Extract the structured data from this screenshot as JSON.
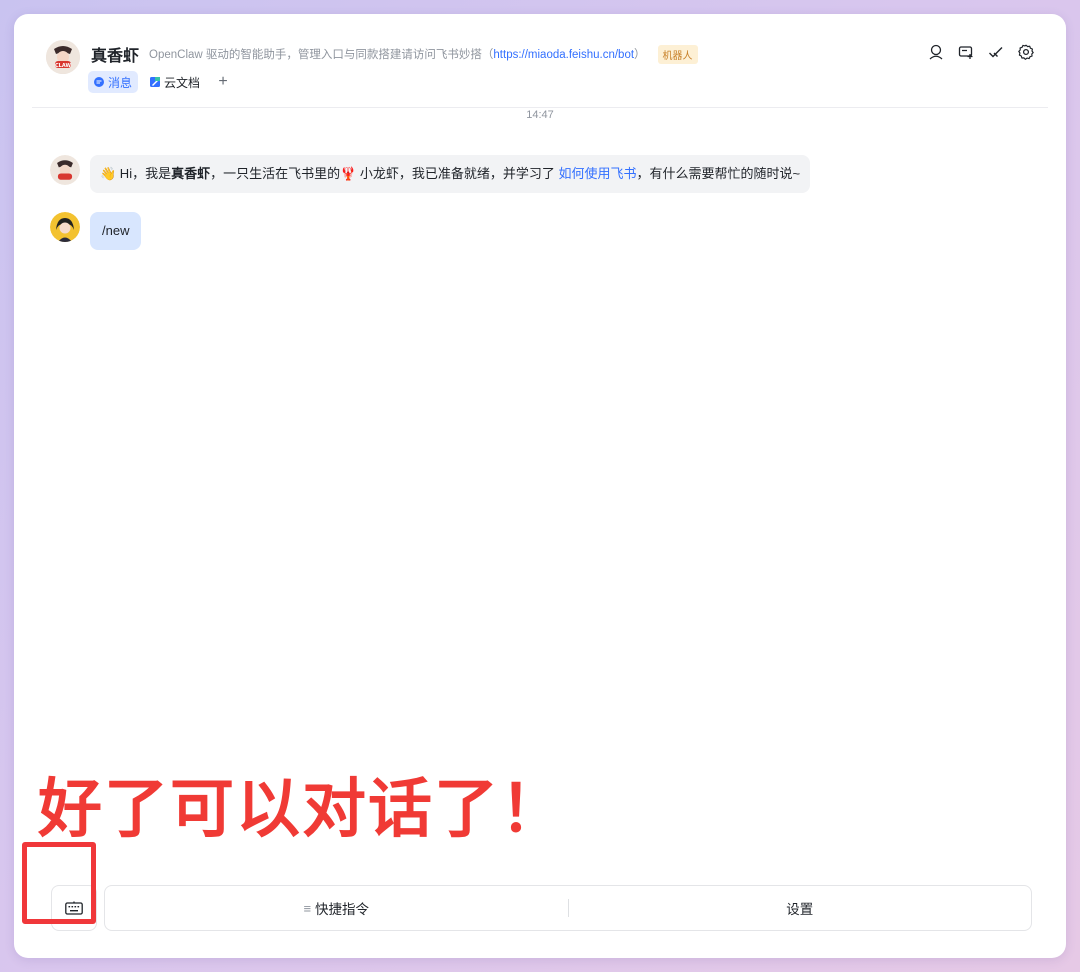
{
  "header": {
    "bot_name": "真香虾",
    "description_prefix": "OpenClaw 驱动的智能助手，管理入口与同款搭建请访问飞书妙搭（",
    "description_link": "https://miaoda.feishu.cn/bot",
    "description_suffix": "）",
    "badge": "机器人",
    "avatar_text": "CLAW",
    "tabs": [
      {
        "label": "消息",
        "icon": "message-icon",
        "active": true
      },
      {
        "label": "云文档",
        "icon": "doc-icon",
        "active": false
      }
    ],
    "add_tab": "+",
    "actions": [
      {
        "name": "member-search-icon"
      },
      {
        "name": "add-group-icon"
      },
      {
        "name": "check-icon"
      },
      {
        "name": "settings-gear-icon"
      }
    ]
  },
  "chat": {
    "timestamp": "14:47",
    "messages": [
      {
        "sender": "bot",
        "emoji_wave": "👋",
        "text_1": " Hi，我是",
        "bold_name": "真香虾",
        "text_2": "，一只生活在飞书里的",
        "emoji_lobster": "🦞",
        "text_3": " 小龙虾，我已准备就绪，并学习了 ",
        "link_text": "如何使用飞书",
        "text_4": "，有什么需要帮忙的随时说~"
      },
      {
        "sender": "user",
        "text": "/new"
      }
    ]
  },
  "overlay": {
    "caption": "好了可以对话了！",
    "color": "#f03a35"
  },
  "bottom_bar": {
    "keyboard_icon": "keyboard-icon",
    "menu_icon_glyph": "≡",
    "quick_commands_label": "快捷指令",
    "settings_label": "设置"
  },
  "colors": {
    "accent": "#3370ff",
    "user_bubble": "#d8e6fe",
    "bot_bubble": "#f2f3f5"
  }
}
